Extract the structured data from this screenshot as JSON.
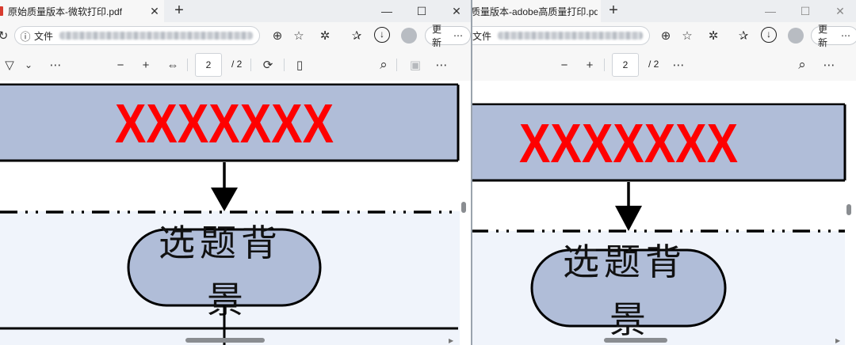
{
  "left": {
    "tab_title": "原始质量版本-微软打印.pdf",
    "tab_close": "✕",
    "address_label": "文件",
    "update_label": "更新",
    "page_current": "2",
    "page_total": "/ 2",
    "doc": {
      "banner_text": "XXXXXXX",
      "node_line1": "选题背",
      "node_line2": "景"
    }
  },
  "right": {
    "tab_title": "质量版本-adobe高质量打印.pdf",
    "address_label": "文件",
    "update_label": "更新",
    "page_current": "2",
    "page_total": "/ 2",
    "doc": {
      "banner_text": "XXXXXXX",
      "node_line1": "选题背",
      "node_line2": "景"
    }
  },
  "icons": {
    "new_tab": "+",
    "minimize": "—",
    "maximize": "☐",
    "close": "✕",
    "refresh": "↻",
    "info": "ⓘ",
    "zoom": "⊕",
    "favorite": "☆",
    "extensions": "✲",
    "collections": "✰",
    "download": "↓",
    "more": "⋯",
    "filter": "▽",
    "chevron": "⌄",
    "zoom_out": "−",
    "zoom_in": "+",
    "fit": "⇔",
    "rotate": "⟳",
    "two_page": "▯",
    "search": "⌕",
    "save": "▣"
  },
  "colors": {
    "banner_fill": "#b0bdd8",
    "banner_text": "#ff0000",
    "node_fill": "#b0bdd8",
    "lower_bg": "#f0f4fb"
  }
}
